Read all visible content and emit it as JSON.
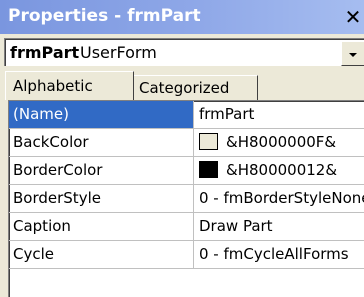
{
  "window": {
    "title": "Properties - frmPart",
    "close_glyph": "✕"
  },
  "object_selector": {
    "name": "frmPart",
    "type": "UserForm"
  },
  "tabs": [
    {
      "label": "Alphabetic",
      "active": true
    },
    {
      "label": "Categorized",
      "active": false
    }
  ],
  "properties": [
    {
      "name": "(Name)",
      "value": "frmPart",
      "selected": true
    },
    {
      "name": "BackColor",
      "value": "&H8000000F&",
      "swatch": "#ece9d8"
    },
    {
      "name": "BorderColor",
      "value": "&H80000012&",
      "swatch": "#000000"
    },
    {
      "name": "BorderStyle",
      "value": "0 - fmBorderStyleNone"
    },
    {
      "name": "Caption",
      "value": "Draw Part"
    },
    {
      "name": "Cycle",
      "value": "0 - fmCycleAllForms"
    }
  ],
  "colors": {
    "titlebar": "#7a96df",
    "selection": "#316ac5",
    "face": "#ece9d8"
  },
  "icons": {
    "close": "close-icon",
    "dropdown": "chevron-down-icon"
  }
}
